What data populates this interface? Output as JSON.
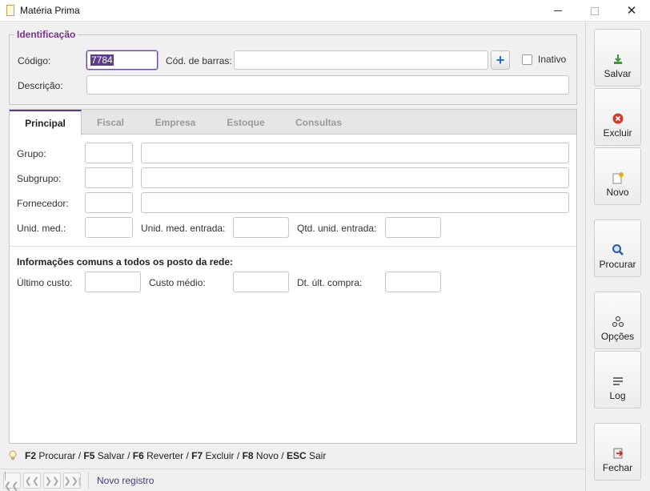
{
  "window": {
    "title": "Matéria Prima",
    "minimize_glyph": "",
    "close_glyph": "✕"
  },
  "identificacao": {
    "legend": "Identificação",
    "codigo_label": "Código:",
    "codigo_value": "7784",
    "barras_label": "Cód. de barras:",
    "barras_value": "",
    "add_barcode": "+",
    "inativo_label": "Inativo",
    "inativo_checked": false,
    "descricao_label": "Descrição:",
    "descricao_value": ""
  },
  "tabs": [
    {
      "label": "Principal",
      "active": true
    },
    {
      "label": "Fiscal",
      "active": false
    },
    {
      "label": "Empresa",
      "active": false
    },
    {
      "label": "Estoque",
      "active": false
    },
    {
      "label": "Consultas",
      "active": false
    }
  ],
  "principal": {
    "grupo_label": "Grupo:",
    "subgrupo_label": "Subgrupo:",
    "fornecedor_label": "Fornecedor:",
    "unid_med_label": "Unid. med.:",
    "unid_med_entrada_label": "Unid. med. entrada:",
    "qtd_unid_entrada_label": "Qtd. unid. entrada:",
    "section_title": "Informações comuns a todos os posto da rede:",
    "ultimo_custo_label": "Último custo:",
    "custo_medio_label": "Custo médio:",
    "dt_ult_compra_label": "Dt. últ. compra:"
  },
  "sidebar": {
    "buttons": [
      {
        "label": "Salvar",
        "icon": "save-icon",
        "color": "#3a9a3a"
      },
      {
        "label": "Excluir",
        "icon": "delete-icon",
        "color": "#d23a2a"
      },
      {
        "label": "Novo",
        "icon": "new-icon",
        "color": "#e0b020"
      },
      {
        "label": "Procurar",
        "icon": "search-icon",
        "color": "#2a5aa8"
      },
      {
        "label": "Opções",
        "icon": "options-icon",
        "color": "#555555"
      },
      {
        "label": "Log",
        "icon": "log-icon",
        "color": "#444444"
      },
      {
        "label": "Fechar",
        "icon": "close-door-icon",
        "color": "#c0302a"
      }
    ]
  },
  "shortcuts": [
    {
      "key": "F2",
      "action": "Procurar"
    },
    {
      "key": "F5",
      "action": "Salvar"
    },
    {
      "key": "F6",
      "action": "Reverter"
    },
    {
      "key": "F7",
      "action": "Excluir"
    },
    {
      "key": "F8",
      "action": "Novo"
    },
    {
      "key": "ESC",
      "action": "Sair"
    }
  ],
  "statusbar": {
    "nav": [
      "first",
      "prev",
      "next",
      "last"
    ],
    "status_text": "Novo registro"
  },
  "colors": {
    "accent": "#5b3b8a",
    "legend": "#7b2f92"
  }
}
